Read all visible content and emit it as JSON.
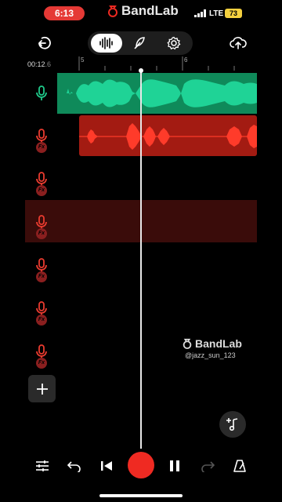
{
  "status": {
    "time": "6:13",
    "network": "LTE",
    "battery": "73"
  },
  "brand": {
    "name": "BandLab"
  },
  "toolbar": {
    "back_icon": "back-arrow-icon",
    "tabs": [
      "waveform-icon",
      "feather-icon",
      "gear-icon"
    ],
    "active_tab": 0,
    "upload_icon": "cloud-upload-icon"
  },
  "timeline": {
    "readout_main": "00:12",
    "readout_fraction": ".6",
    "bar_labels": [
      "5",
      "6"
    ]
  },
  "tracks": [
    {
      "mic_color": "#1fc98a",
      "fx": false,
      "region": "green"
    },
    {
      "mic_color": "#ea3b2f",
      "fx": true,
      "fx_label": "Fx",
      "region": "red"
    },
    {
      "mic_color": "#ea3b2f",
      "fx": true,
      "fx_label": "Fx",
      "region": "none"
    },
    {
      "mic_color": "#ea3b2f",
      "fx": true,
      "fx_label": "Fx",
      "region": "selected"
    },
    {
      "mic_color": "#ea3b2f",
      "fx": true,
      "fx_label": "Fx",
      "region": "none"
    },
    {
      "mic_color": "#ea3b2f",
      "fx": true,
      "fx_label": "Fx",
      "region": "none"
    },
    {
      "mic_color": "#ea3b2f",
      "fx": true,
      "fx_label": "Fx",
      "region": "none"
    }
  ],
  "watermark": {
    "brand": "BandLab",
    "user": "@jazz_sun_123"
  },
  "transport": [
    "mixer-sliders-icon",
    "undo-icon",
    "skip-back-icon",
    "record-button",
    "pause-icon",
    "redo-icon",
    "metronome-icon"
  ],
  "colors": {
    "accent_red": "#ef2a22",
    "green_region": "#0f8a5a",
    "green_wave": "#1fd396",
    "red_region": "#a31b12",
    "red_wave": "#ff3b2a"
  }
}
